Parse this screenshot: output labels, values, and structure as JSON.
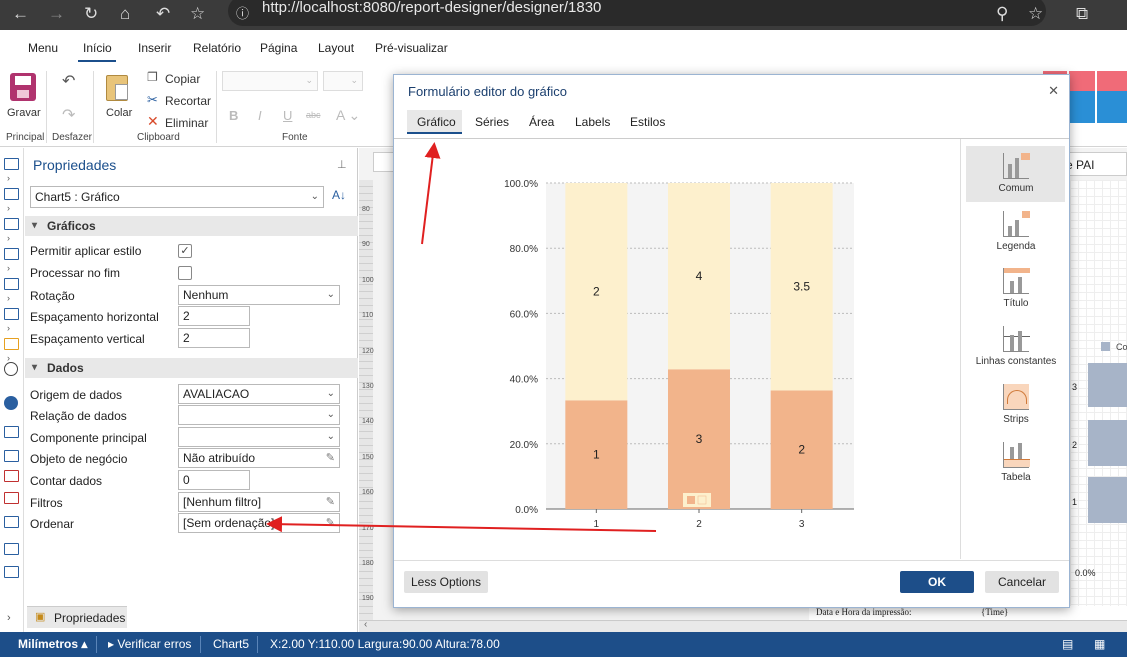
{
  "browser": {
    "url": "http://localhost:8080/report-designer/designer/1830"
  },
  "menu_tabs": [
    {
      "label": "Menu"
    },
    {
      "label": "Início"
    },
    {
      "label": "Inserir"
    },
    {
      "label": "Relatório"
    },
    {
      "label": "Página"
    },
    {
      "label": "Layout"
    },
    {
      "label": "Pré-visualizar"
    }
  ],
  "ribbon": {
    "gravar": "Gravar",
    "colar": "Colar",
    "copiar": "Copiar",
    "recortar": "Recortar",
    "eliminar": "Eliminar",
    "group_principal": "Principal",
    "group_desfazer": "Desfazer",
    "group_clipboard": "Clipboard",
    "group_fonte": "Fonte"
  },
  "properties": {
    "title": "Propriedades",
    "component_select": "Chart5 : Gráfico",
    "section_graficos": "Gráficos",
    "section_dados": "Dados",
    "rows_graficos": {
      "permitir": "Permitir aplicar estilo",
      "processar": "Processar no fim",
      "rotacao": "Rotação",
      "rotacao_value": "Nenhum",
      "esp_h": "Espaçamento horizontal",
      "esp_h_value": "2",
      "esp_v": "Espaçamento vertical",
      "esp_v_value": "2"
    },
    "rows_dados": {
      "origem": "Origem de dados",
      "origem_value": "AVALIACAO",
      "relacao": "Relação de dados",
      "componente": "Componente principal",
      "objeto": "Objeto de negócio",
      "objeto_value": "Não atribuído",
      "contar": "Contar dados",
      "contar_value": "0",
      "filtros": "Filtros",
      "filtros_value": "[Nenhum filtro]",
      "ordenar": "Ordenar",
      "ordenar_value": "[Sem ordenação]"
    },
    "bottom_tab": "Propriedades"
  },
  "design_bg": {
    "pai_tab": "e PAI",
    "footer_text": "Data e Hora da impressão:",
    "time_text": "{Time}",
    "right_ticks": [
      "3",
      "2",
      "1",
      "0.0%"
    ],
    "legend_fragment": "Co"
  },
  "ruler_ticks": [
    "80",
    "90",
    "100",
    "110",
    "120",
    "130",
    "140",
    "150",
    "160",
    "170",
    "180",
    "190"
  ],
  "dialog": {
    "title": "Formulário editor do gráfico",
    "tabs": [
      {
        "label": "Gráfico"
      },
      {
        "label": "Séries"
      },
      {
        "label": "Área"
      },
      {
        "label": "Labels"
      },
      {
        "label": "Estilos"
      }
    ],
    "right_items": [
      {
        "label": "Comum"
      },
      {
        "label": "Legenda"
      },
      {
        "label": "Título"
      },
      {
        "label": "Linhas constantes"
      },
      {
        "label": "Strips"
      },
      {
        "label": "Tabela"
      }
    ],
    "less_options": "Less Options",
    "ok": "OK",
    "cancel": "Cancelar"
  },
  "chart_data": {
    "type": "bar",
    "stacked": "100%",
    "categories": [
      "1",
      "2",
      "3"
    ],
    "series": [
      {
        "values": [
          1,
          3,
          2
        ],
        "color": "#f2b48b"
      },
      {
        "values": [
          2,
          4,
          3.5
        ],
        "color": "#fdf0cd"
      }
    ],
    "ylim": [
      0,
      100
    ],
    "ytick_labels": [
      "0.0%",
      "20.0%",
      "40.0%",
      "60.0%",
      "80.0%",
      "100.0%"
    ],
    "grid": true
  },
  "status": {
    "units": "Milímetros",
    "verificar": "Verificar erros",
    "component": "Chart5",
    "coords": "X:2.00 Y:110.00 Largura:90.00 Altura:78.00"
  },
  "colors": {
    "accent": "#1d4e89",
    "arrow": "#e02020"
  }
}
